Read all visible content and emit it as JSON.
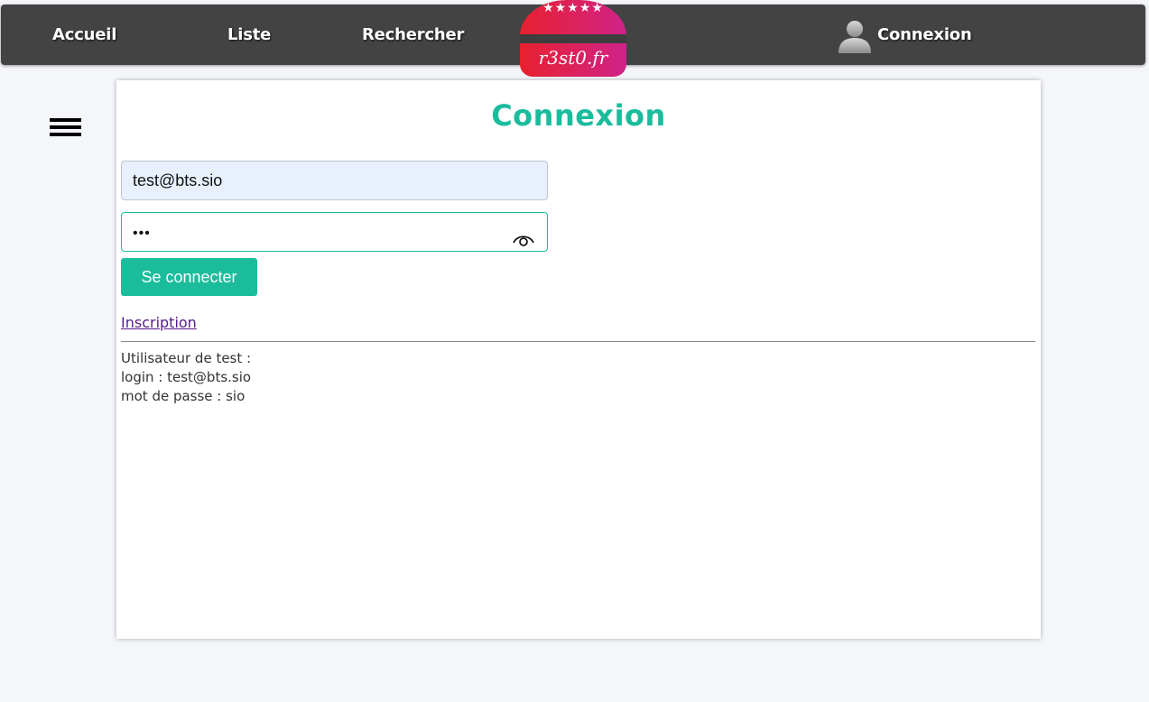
{
  "nav": {
    "home": "Accueil",
    "list": "Liste",
    "search": "Rechercher",
    "login": "Connexion"
  },
  "logo": {
    "stars": "★★★★★",
    "text": "r3st0.fr"
  },
  "form": {
    "title": "Connexion",
    "email_value": "test@bts.sio",
    "password_mask": "•••",
    "submit_label": "Se connecter",
    "register_link": "Inscription"
  },
  "test_info": {
    "line1": "Utilisateur de test :",
    "line2": "login : test@bts.sio",
    "line3": "mot de passe : sio"
  },
  "colors": {
    "accent": "#1abc9c",
    "navbar": "#434343",
    "autofill": "#e8f0fe",
    "link": "#551a8b"
  },
  "icons": [
    "user-avatar-icon",
    "eye-icon",
    "hamburger-menu-icon"
  ]
}
